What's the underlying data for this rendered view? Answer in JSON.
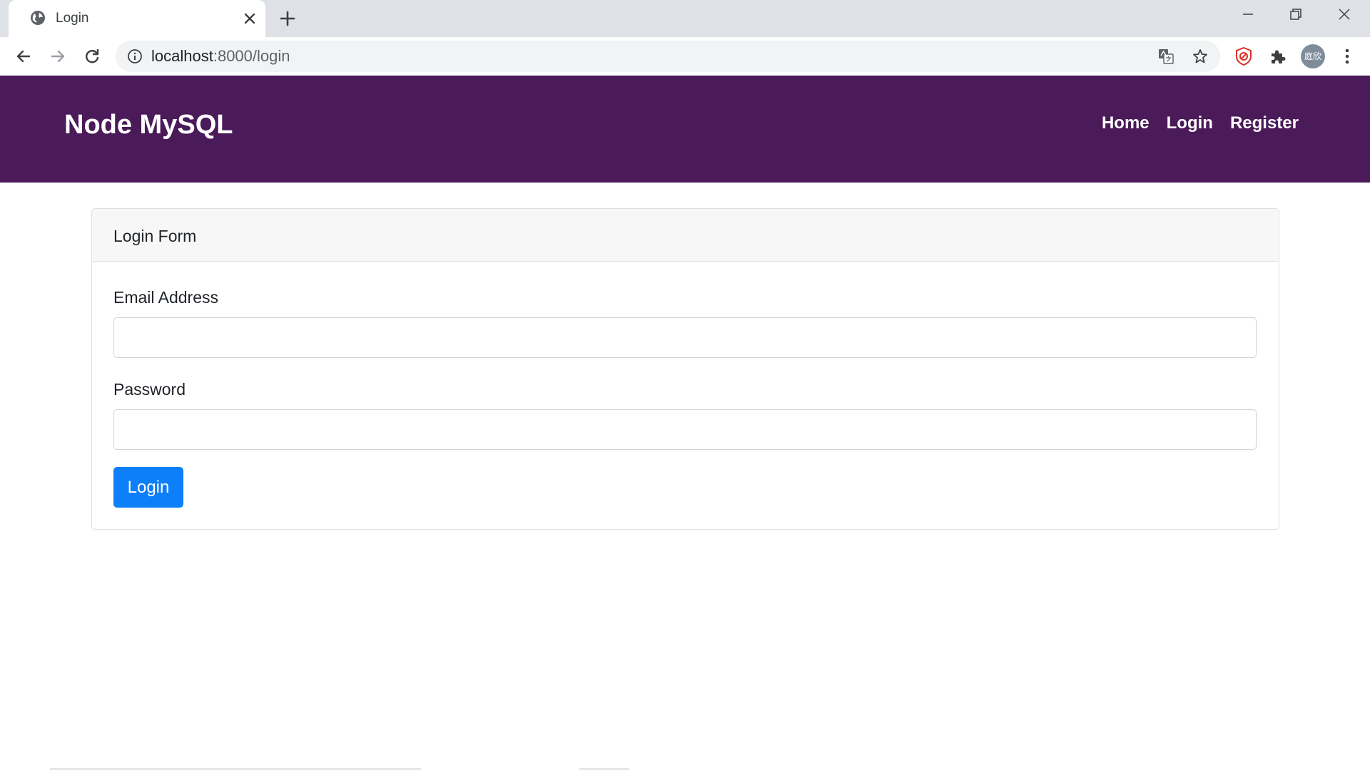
{
  "browser": {
    "tab": {
      "title": "Login",
      "favicon": "globe-icon"
    },
    "address": {
      "host": "localhost",
      "path": ":8000/login"
    },
    "profile_initials": "庭欣",
    "icons": {
      "close": "close-icon",
      "new_tab": "plus-icon",
      "back": "arrow-left-icon",
      "forward": "arrow-right-icon",
      "reload": "reload-icon",
      "info": "info-icon",
      "translate": "translate-icon",
      "bookmark": "star-icon",
      "extension": "puzzle-icon",
      "adblock": "shield-icon",
      "menu": "kebab-menu-icon"
    }
  },
  "navbar": {
    "brand": "Node MySQL",
    "links": [
      "Home",
      "Login",
      "Register"
    ],
    "background": "#4a1a59"
  },
  "login_card": {
    "title": "Login Form",
    "email_label": "Email Address",
    "email_value": "",
    "password_label": "Password",
    "password_value": "",
    "submit_label": "Login",
    "button_color": "#0d7ff8"
  }
}
